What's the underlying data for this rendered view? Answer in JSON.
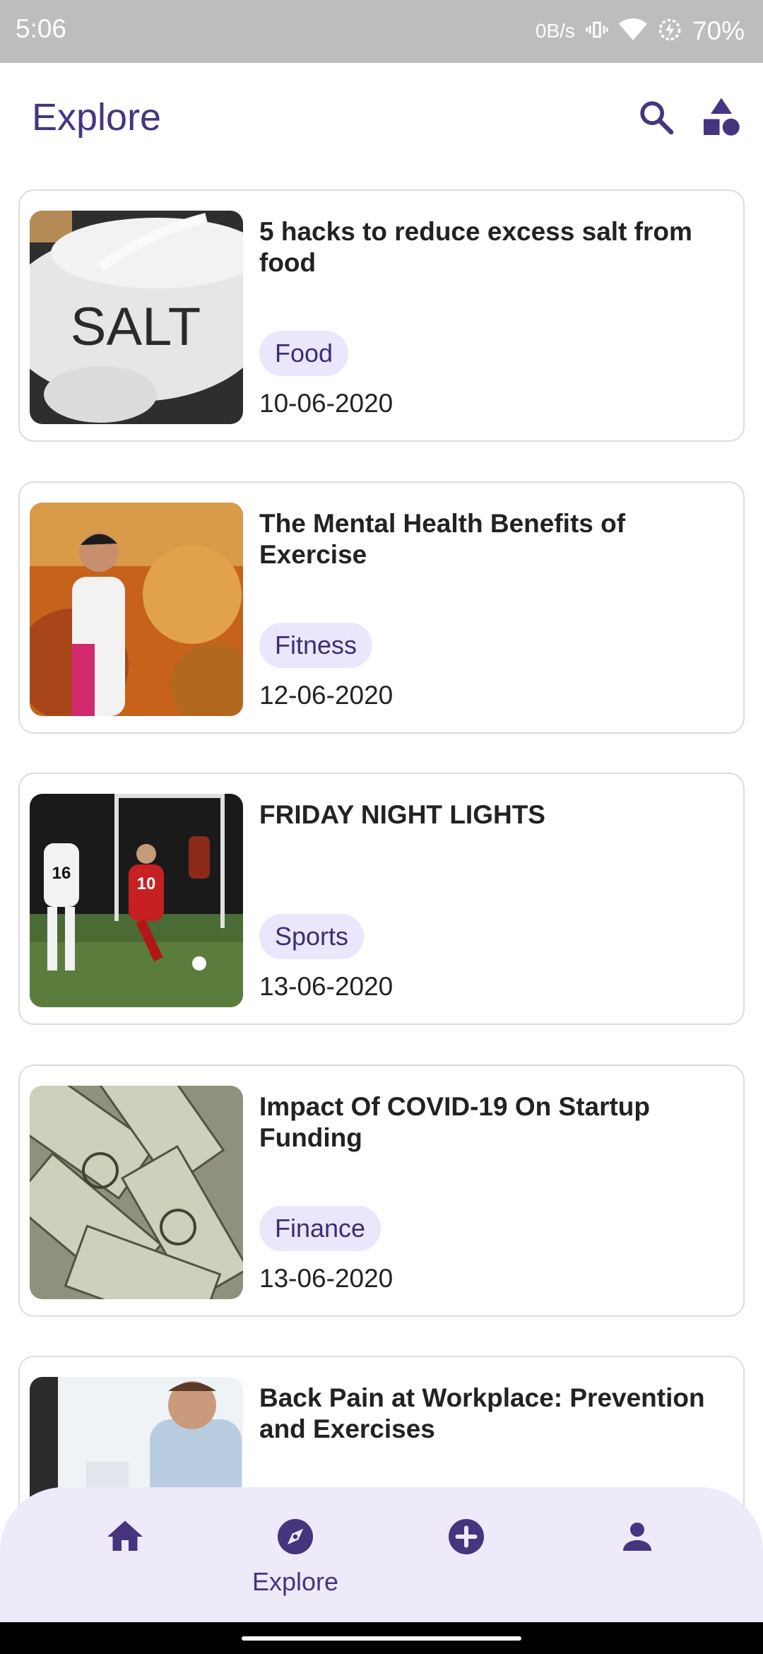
{
  "status_bar": {
    "time": "5:06",
    "data_rate": "0B/s",
    "battery": "70%",
    "icons": [
      "vibrate-icon",
      "wifi-icon",
      "battery-saver-icon"
    ]
  },
  "app_bar": {
    "title": "Explore",
    "icons": [
      "search-icon",
      "categories-icon"
    ],
    "accent_color": "#47347f"
  },
  "articles": [
    {
      "title": "5 hacks to reduce excess salt from food",
      "category": "Food",
      "date": "10-06-2020",
      "image_text": "SALT"
    },
    {
      "title": "The Mental Health Benefits of Exercise",
      "category": "Fitness",
      "date": "12-06-2020"
    },
    {
      "title": "FRIDAY NIGHT LIGHTS",
      "category": "Sports",
      "date": "13-06-2020",
      "image_text": [
        "16",
        "10"
      ]
    },
    {
      "title": "Impact Of COVID-19 On Startup Funding",
      "category": "Finance",
      "date": "13-06-2020"
    },
    {
      "title": "Back Pain at Workplace: Prevention and Exercises"
    }
  ],
  "bottom_nav": {
    "items": [
      {
        "icon": "home-icon"
      },
      {
        "icon": "compass-icon",
        "label": "Explore",
        "active": true
      },
      {
        "icon": "add-circle-icon"
      },
      {
        "icon": "person-icon"
      }
    ],
    "background": "#eeeaf9"
  },
  "colors": {
    "chip_bg": "#ebe6fb",
    "chip_text": "#3c2f70"
  }
}
